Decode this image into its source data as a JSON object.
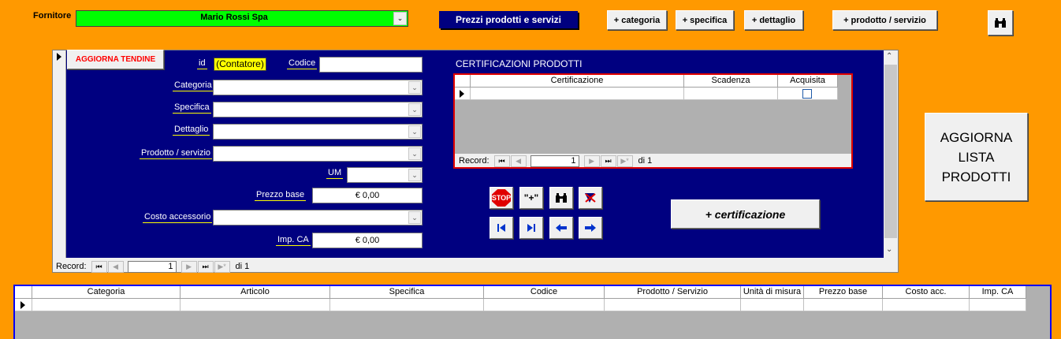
{
  "header": {
    "fornitore_label": "Fornitore",
    "fornitore_value": "Mario Rossi Spa",
    "title": "Prezzi prodotti e servizi",
    "btn_categoria": "+ categoria",
    "btn_specifica": "+ specifica",
    "btn_dettaglio": "+ dettaglio",
    "btn_prodotto": "+ prodotto / servizio",
    "find_icon": "binoculars-icon"
  },
  "form": {
    "aggiorna_tendine": "AGGIORNA TENDINE",
    "id_label": "id",
    "id_value": "(Contatore)",
    "codice_label": "Codice",
    "codice_value": "",
    "categoria_label": "Categoria",
    "specifica_label": "Specifica",
    "dettaglio_label": "Dettaglio",
    "prodotto_label": "Prodotto / servizio",
    "um_label": "UM",
    "prezzo_label": "Prezzo base",
    "prezzo_value": "€ 0,00",
    "costo_label": "Costo accessorio",
    "impca_label": "Imp. CA",
    "impca_value": "€ 0,00",
    "record_label": "Record:",
    "record_current": "1",
    "record_of": "di 1"
  },
  "certificazioni": {
    "title": "CERTIFICAZIONI PRODOTTI",
    "columns": [
      "Certificazione",
      "Scadenza",
      "Acquisita"
    ],
    "record_label": "Record:",
    "record_current": "1",
    "record_of": "di 1",
    "add_button": "+ certificazione"
  },
  "actions": {
    "stop": "STOP",
    "new": "\"+\"",
    "colors": {
      "stop": "#e00000",
      "nav": "#0033cc"
    }
  },
  "aggiorna_lista": "AGGIORNA LISTA PRODOTTI",
  "list": {
    "columns": [
      "Categoria",
      "Articolo",
      "Specifica",
      "Codice",
      "Prodotto / Servizio",
      "Unità di misura",
      "Prezzo base",
      "Costo acc.",
      "Imp. CA"
    ]
  },
  "colors": {
    "background": "#ff9900",
    "form": "#000080",
    "supplier": "#00ff00"
  }
}
